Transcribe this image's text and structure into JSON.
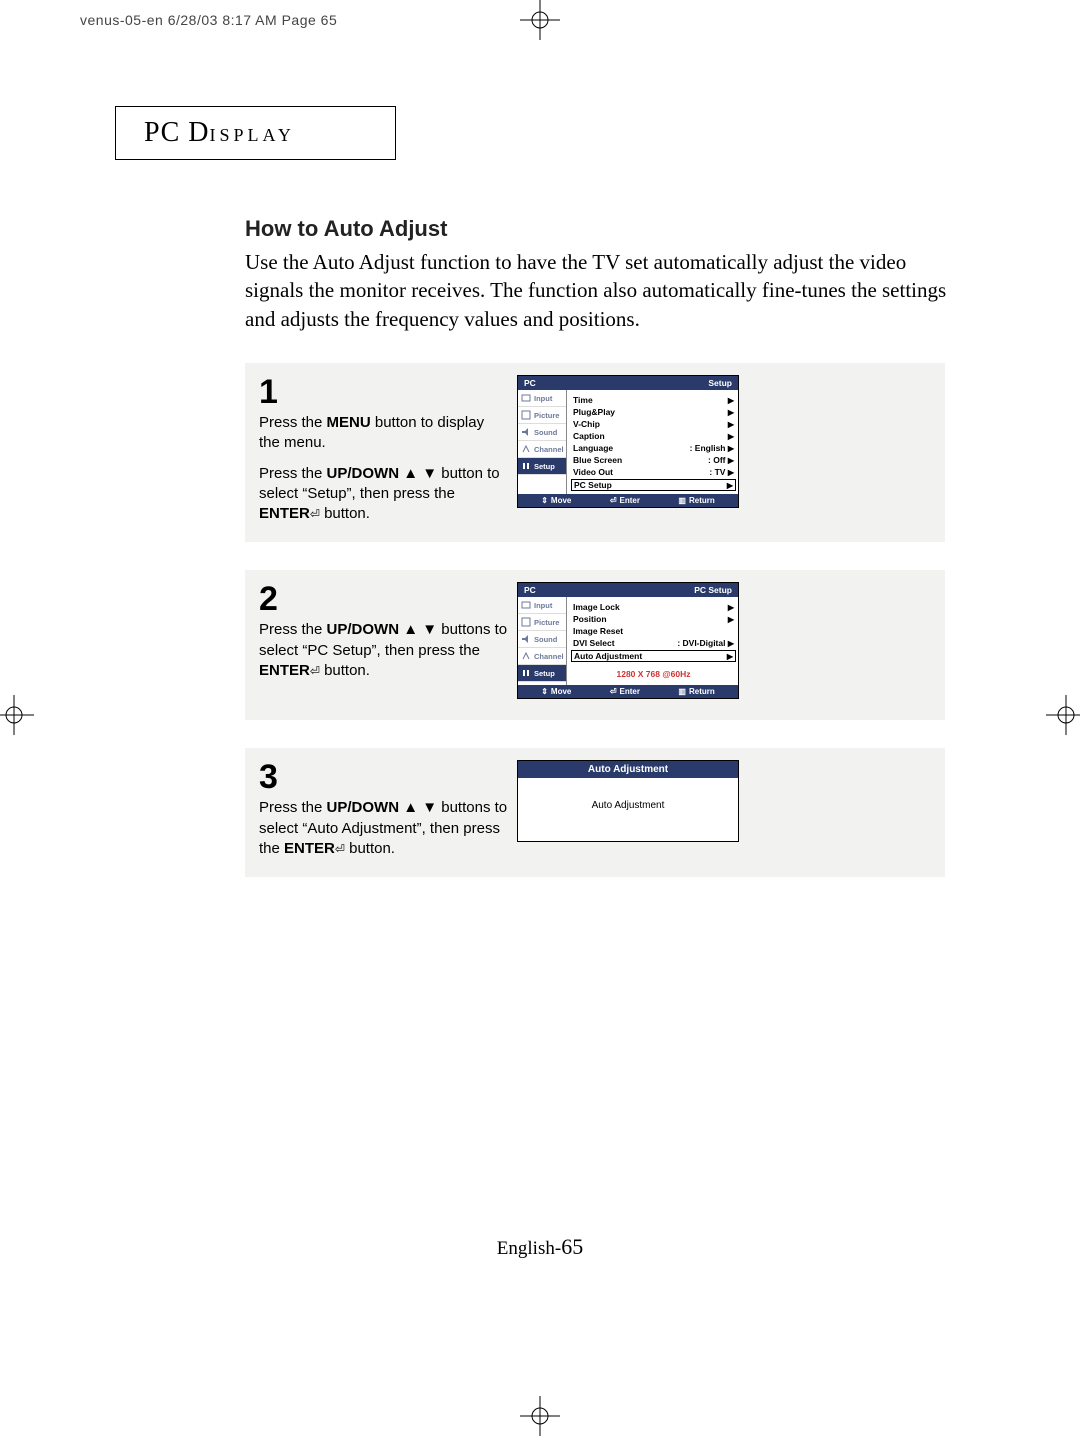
{
  "crop": "venus-05-en  6/28/03 8:17 AM  Page 65",
  "title": {
    "t1": "PC D",
    "t2": "ISPLAY"
  },
  "subhead": "How to Auto Adjust",
  "intro": "Use the Auto Adjust function to have the TV set automatically adjust the video signals the monitor receives.   The function also automatically fine-tunes the settings and adjusts the frequency values and positions.",
  "steps": {
    "1": {
      "num": "1",
      "p1a": "Press the ",
      "p1b": "MENU",
      "p1c": " button to display the menu.",
      "p2a": "Press the ",
      "p2b": "UP/DOWN",
      "p2c": " button to select “Setup”, then press the ",
      "p2d": "ENTER",
      "p2e": " button."
    },
    "2": {
      "num": "2",
      "p1a": "Press the ",
      "p1b": "UP/DOWN",
      "p1c": " buttons to select “PC Setup”, then press the ",
      "p1d": "ENTER",
      "p1e": " button."
    },
    "3": {
      "num": "3",
      "p1a": "Press the ",
      "p1b": "UP/DOWN",
      "p1c": " buttons to select “Auto Adjustment”, then press the ",
      "p1d": "ENTER",
      "p1e": "  button."
    }
  },
  "osd_common": {
    "tabs": [
      "Input",
      "Picture",
      "Sound",
      "Channel",
      "Setup"
    ],
    "foot_move": "Move",
    "foot_enter": "Enter",
    "foot_return": "Return"
  },
  "osd1": {
    "src": "PC",
    "title": "Setup",
    "rows": [
      {
        "label": "Time",
        "val": "",
        "arrow": true
      },
      {
        "label": "Plug&Play",
        "val": "",
        "arrow": true
      },
      {
        "label": "V-Chip",
        "val": "",
        "arrow": true
      },
      {
        "label": "Caption",
        "val": "",
        "arrow": true
      },
      {
        "label": "Language",
        "val": ": English",
        "arrow": true
      },
      {
        "label": "Blue Screen",
        "val": ": Off",
        "arrow": true
      },
      {
        "label": "Video Out",
        "val": ": TV",
        "arrow": true
      },
      {
        "label": "PC Setup",
        "val": "",
        "arrow": true,
        "hl": true
      }
    ]
  },
  "osd2": {
    "src": "PC",
    "title": "PC Setup",
    "rows": [
      {
        "label": "Image Lock",
        "val": "",
        "arrow": true
      },
      {
        "label": "Position",
        "val": "",
        "arrow": true
      },
      {
        "label": "Image Reset",
        "val": "",
        "arrow": false
      },
      {
        "label": "DVI Select",
        "val": ": DVI-Digital",
        "arrow": true
      },
      {
        "label": "Auto Adjustment",
        "val": "",
        "arrow": true,
        "hl": true
      }
    ],
    "resolution": "1280 X 768 @60Hz"
  },
  "osd3": {
    "title": "Auto Adjustment",
    "body": "Auto Adjustment"
  },
  "footer": {
    "label": "English-",
    "page": "65"
  }
}
